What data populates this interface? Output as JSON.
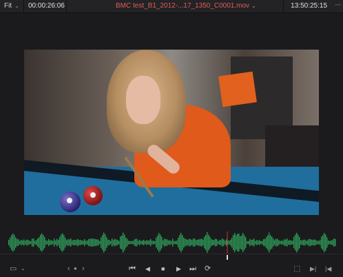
{
  "topbar": {
    "zoom_label": "Fit",
    "timecode_duration": "00:00:26:06",
    "clip_name": "BMC test_B1_2012-...17_1350_C0001.mov",
    "timecode_current": "13:50:25:15",
    "more_glyph": "···",
    "chevron": "⌄"
  },
  "controls": {
    "viewer_options_glyph": "▭",
    "viewer_options_chev": "⌄",
    "prev_glyph": "‹",
    "dot_glyph": "●",
    "next_glyph": "›",
    "first_frame_glyph": "⏮",
    "reverse_glyph": "◀",
    "stop_glyph": "■",
    "play_glyph": "▶",
    "last_frame_glyph": "⏭",
    "loop_glyph": "⟳",
    "fullscreen_glyph": "⬚",
    "mark_in_glyph": "▶|",
    "mark_out_glyph": "|◀"
  },
  "colors": {
    "waveform": "#2fa05a",
    "clip_name": "#e25a5a",
    "playhead": "#c83a3a"
  }
}
